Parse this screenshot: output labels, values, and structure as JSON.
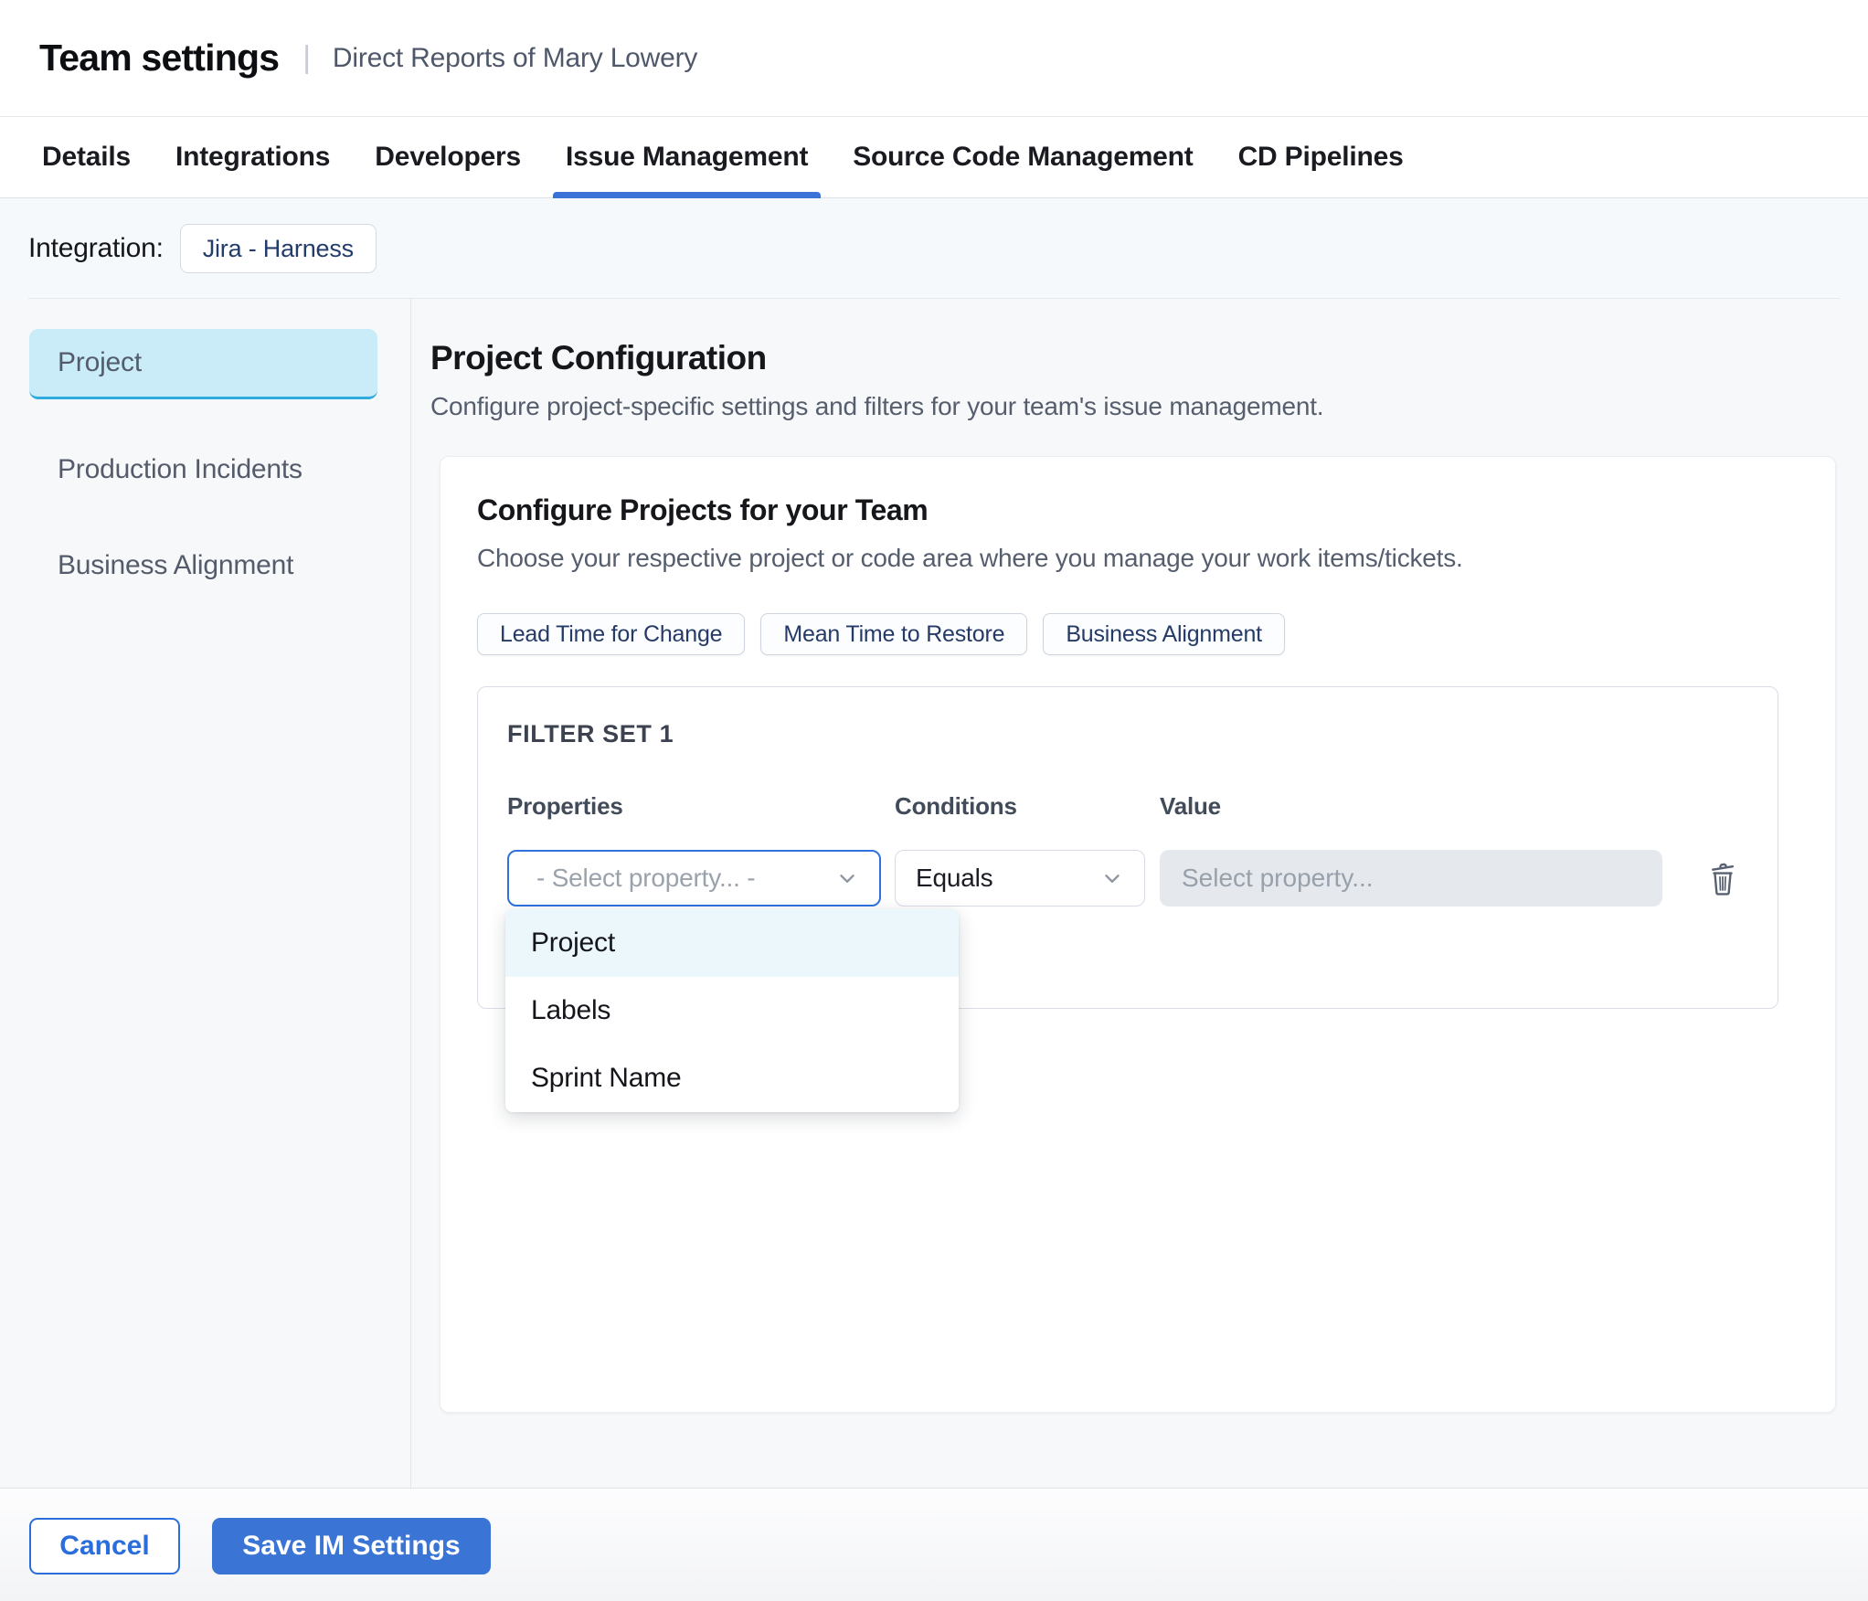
{
  "header": {
    "title": "Team settings",
    "separator": "|",
    "subtitle": "Direct Reports of Mary Lowery"
  },
  "tabs": {
    "items": [
      {
        "label": "Details",
        "active": false
      },
      {
        "label": "Integrations",
        "active": false
      },
      {
        "label": "Developers",
        "active": false
      },
      {
        "label": "Issue Management",
        "active": true
      },
      {
        "label": "Source Code Management",
        "active": false
      },
      {
        "label": "CD Pipelines",
        "active": false
      }
    ]
  },
  "integration": {
    "label": "Integration:",
    "chip": "Jira - Harness"
  },
  "sidebar": {
    "items": [
      {
        "label": "Project",
        "selected": true
      },
      {
        "label": "Production Incidents",
        "selected": false
      },
      {
        "label": "Business Alignment",
        "selected": false
      }
    ]
  },
  "main": {
    "title": "Project Configuration",
    "description": "Configure project-specific settings and filters for your team's issue management.",
    "card": {
      "title": "Configure Projects for your Team",
      "description": "Choose your respective project or code area where you manage your work items/tickets.",
      "chips": [
        {
          "label": "Lead Time for Change"
        },
        {
          "label": "Mean Time to Restore"
        },
        {
          "label": "Business Alignment"
        }
      ],
      "filter_set": {
        "title": "FILTER SET 1",
        "columns": {
          "properties": "Properties",
          "conditions": "Conditions",
          "value": "Value"
        },
        "properties_select": {
          "placeholder": "- Select property... -",
          "state": "open-focused"
        },
        "conditions_select": {
          "value": "Equals"
        },
        "value_input": {
          "placeholder": "Select property...",
          "value": "",
          "disabled": true
        },
        "dropdown": {
          "items": [
            {
              "label": "Project",
              "highlighted": true
            },
            {
              "label": "Labels",
              "highlighted": false
            },
            {
              "label": "Sprint Name",
              "highlighted": false
            }
          ]
        }
      }
    }
  },
  "footer": {
    "cancel_label": "Cancel",
    "save_label": "Save IM Settings"
  },
  "icons": {
    "properties_chevron": "chevron-down",
    "conditions_chevron": "chevron-down",
    "delete_filter": "trash"
  },
  "colors": {
    "accent_blue": "#3b72d8",
    "primary_button": "#3a75d6",
    "cancel_blue": "#2a6edb",
    "selected_sidebar_bg": "#c9ecf8",
    "selected_sidebar_border": "#2fabdf",
    "focused_select_border": "#2e72de",
    "dropdown_highlight": "#ecf7fc",
    "disabled_input_bg": "#e5e9ee",
    "page_background": "#f6f8fa"
  }
}
